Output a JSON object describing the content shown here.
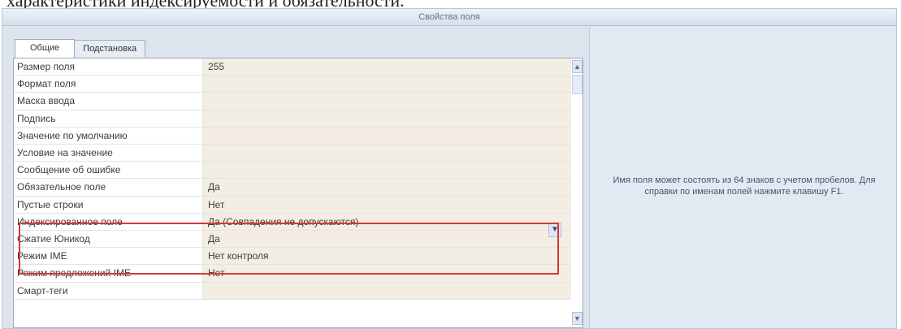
{
  "document": {
    "text": "характеристики индексируемости и обязательности."
  },
  "panel": {
    "title": "Свойства поля"
  },
  "tabs": [
    {
      "label": "Общие",
      "active": true
    },
    {
      "label": "Подстановка",
      "active": false
    }
  ],
  "properties": [
    {
      "label": "Размер поля",
      "value": "255"
    },
    {
      "label": "Формат поля",
      "value": ""
    },
    {
      "label": "Маска ввода",
      "value": ""
    },
    {
      "label": "Подпись",
      "value": ""
    },
    {
      "label": "Значение по умолчанию",
      "value": ""
    },
    {
      "label": "Условие на значение",
      "value": ""
    },
    {
      "label": "Сообщение об ошибке",
      "value": ""
    },
    {
      "label": "Обязательное поле",
      "value": "Да"
    },
    {
      "label": "Пустые строки",
      "value": "Нет"
    },
    {
      "label": "Индексированное поле",
      "value": "Да (Совпадения не допускаются)"
    },
    {
      "label": "Сжатие Юникод",
      "value": "Да"
    },
    {
      "label": "Режим IME",
      "value": "Нет контроля"
    },
    {
      "label": "Режим предложений IME",
      "value": "Нет"
    },
    {
      "label": "Смарт-теги",
      "value": ""
    }
  ],
  "help": {
    "text": "Имя поля может состоять из 64 знаков с учетом пробелов. Для справки по именам полей нажмите клавишу F1."
  },
  "colors": {
    "highlight": "#d23a3a",
    "value_bg": "#f3ede4",
    "panel_bg": "#dde4ee"
  },
  "icons": {
    "scroll_up": "scroll-up-icon",
    "scroll_down": "scroll-down-icon",
    "dropdown": "chevron-down-icon"
  }
}
